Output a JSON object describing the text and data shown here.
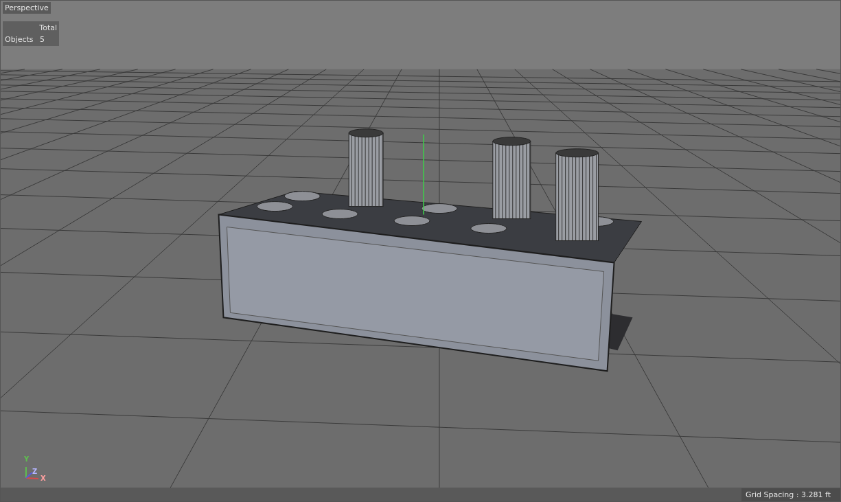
{
  "viewport": {
    "title": "Perspective"
  },
  "hud": {
    "header": "Total",
    "rows": [
      {
        "label": "Objects",
        "value": "5"
      }
    ]
  },
  "axis_gizmo": [
    {
      "label": "Y",
      "color": "#5fbf4f"
    },
    {
      "label": "Z",
      "color": "#b4b4ff"
    },
    {
      "label": "X",
      "color": "#ffa0a0"
    }
  ],
  "status_bar": {
    "text": "Grid Spacing : 3.281 ft"
  }
}
